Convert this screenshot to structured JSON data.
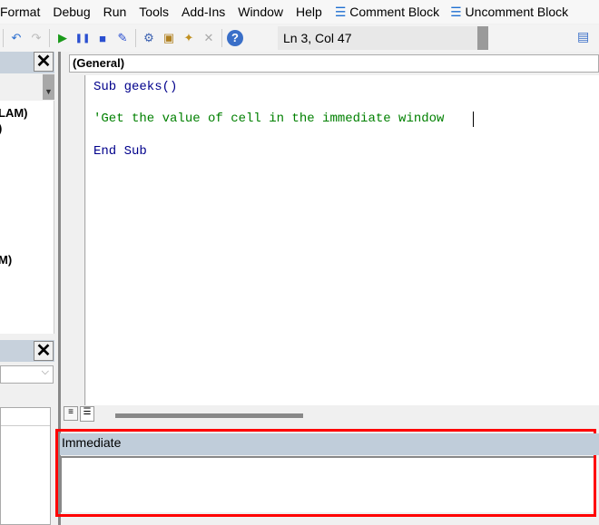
{
  "menu": [
    "Format",
    "Debug",
    "Run",
    "Tools",
    "Add-Ins",
    "Window",
    "Help"
  ],
  "comment_block": "Comment Block",
  "uncomment_block": "Uncomment Block",
  "toolbar": {
    "icons": [
      "undo-icon",
      "redo-icon",
      "run-icon",
      "break-icon",
      "reset-icon",
      "design-mode-icon",
      "project-explorer-icon",
      "properties-icon",
      "object-browser-icon",
      "toolbox-icon",
      "help-icon"
    ],
    "cursor_position": "Ln 3, Col 47"
  },
  "project_tree": [
    "LAM)",
    ")",
    "M)"
  ],
  "code_window": {
    "object_dropdown": "(General)",
    "lines": [
      {
        "text": "Sub geeks()",
        "color": "#00008b"
      },
      {
        "text": "'Get the value of cell in the immediate window",
        "color": "#008000"
      },
      {
        "text": "End Sub",
        "color": "#00008b"
      }
    ]
  },
  "immediate": {
    "title": "Immediate",
    "value": ""
  },
  "colors": {
    "highlight": "#ff0000",
    "panel_header": "#c0cdda",
    "keyword": "#00008b",
    "comment": "#008000"
  }
}
